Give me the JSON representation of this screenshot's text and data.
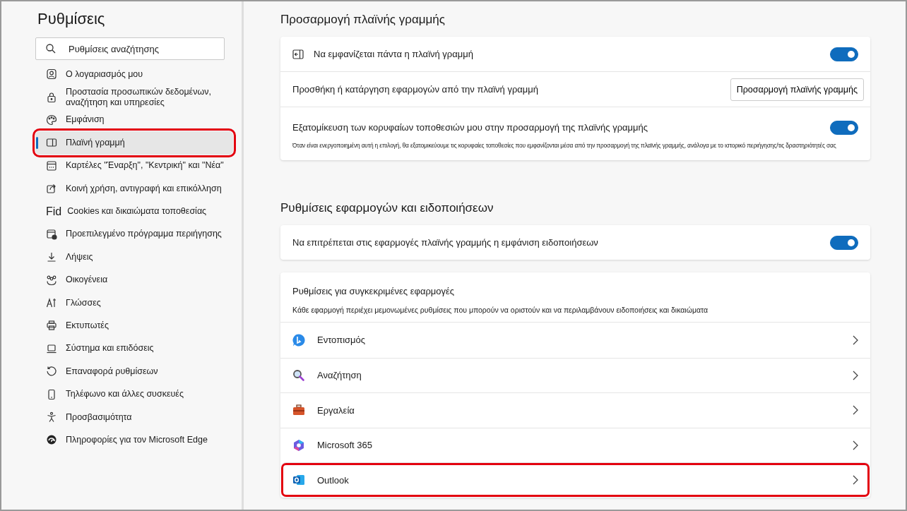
{
  "sidebar": {
    "title": "Ρυθμίσεις",
    "search": {
      "placeholder": "Ρυθμίσεις αναζήτησης"
    },
    "items": [
      {
        "label": "Ο λογαριασμός μου",
        "selected": false,
        "highlighted": false
      },
      {
        "label": "Προστασία προσωπικών δεδομένων, αναζήτηση και υπηρεσίες",
        "selected": false,
        "highlighted": false
      },
      {
        "label": "Εμφάνιση",
        "selected": false,
        "highlighted": false
      },
      {
        "label": "Πλαϊνή γραμμή",
        "selected": true,
        "highlighted": true
      },
      {
        "label": "Καρτέλες \"Έναρξη\", \"Κεντρική\" και \"Νέα\"",
        "selected": false,
        "highlighted": false
      },
      {
        "label": "Κοινή χρήση, αντιγραφή και επικόλληση",
        "selected": false,
        "highlighted": false
      },
      {
        "label": "Cookies και δικαιώματα τοποθεσίας",
        "icon_text": "Fid",
        "selected": false,
        "highlighted": false
      },
      {
        "label": "Προεπιλεγμένο πρόγραμμα περιήγησης",
        "selected": false,
        "highlighted": false
      },
      {
        "label": "Λήψεις",
        "selected": false,
        "highlighted": false
      },
      {
        "label": "Οικογένεια",
        "selected": false,
        "highlighted": false
      },
      {
        "label": "Γλώσσες",
        "selected": false,
        "highlighted": false
      },
      {
        "label": "Εκτυπωτές",
        "selected": false,
        "highlighted": false
      },
      {
        "label": "Σύστημα και επιδόσεις",
        "selected": false,
        "highlighted": false
      },
      {
        "label": "Επαναφορά ρυθμίσεων",
        "selected": false,
        "highlighted": false
      },
      {
        "label": "Τηλέφωνο και άλλες συσκευές",
        "selected": false,
        "highlighted": false
      },
      {
        "label": "Προσβασιμότητα",
        "selected": false,
        "highlighted": false
      },
      {
        "label": "Πληροφορίες για τον Microsoft Edge",
        "selected": false,
        "highlighted": false
      }
    ]
  },
  "customize_section": {
    "heading": "Προσαρμογή πλαϊνής γραμμής",
    "rows": [
      {
        "kind": "toggle",
        "label": "Να εμφανίζεται πάντα η πλαϊνή γραμμή",
        "on": true,
        "has_icon": true
      },
      {
        "kind": "button",
        "label": "Προσθήκη ή κατάργηση εφαρμογών από την πλαϊνή γραμμή",
        "button": "Προσαρμογή πλαϊνής γραμμής"
      },
      {
        "kind": "toggle",
        "label": "Εξατομίκευση των κορυφαίων τοποθεσιών μου στην προσαρμογή της πλαϊνής γραμμής",
        "on": true,
        "has_icon": false,
        "description": "Όταν είναι ενεργοποιημένη αυτή η επιλογή, θα εξατομικεύουμε τις κορυφαίες τοποθεσίες που εμφανίζονται μέσα από την προσαρμογή της πλαϊνής γραμμής, ανάλογα με το ιστορικό περιήγησης/τις δραστηριότητές σας"
      }
    ]
  },
  "apps_section": {
    "heading": "Ρυθμίσεις εφαρμογών και ειδοποιήσεων",
    "notifications": {
      "label": "Να επιτρέπεται στις εφαρμογές πλαϊνής γραμμής η εμφάνιση ειδοποιήσεων",
      "on": true
    },
    "specific": {
      "title": "Ρυθμίσεις για συγκεκριμένες εφαρμογές",
      "description": "Κάθε εφαρμογή περιέχει μεμονωμένες ρυθμίσεις που μπορούν να οριστούν και να περιλαμβάνουν ειδοποιήσεις και δικαιώματα",
      "apps": [
        {
          "label": "Εντοπισμός",
          "highlighted": false
        },
        {
          "label": "Αναζήτηση",
          "highlighted": false
        },
        {
          "label": "Εργαλεία",
          "highlighted": false
        },
        {
          "label": "Microsoft 365",
          "highlighted": false
        },
        {
          "label": "Outlook",
          "highlighted": true
        }
      ]
    }
  }
}
